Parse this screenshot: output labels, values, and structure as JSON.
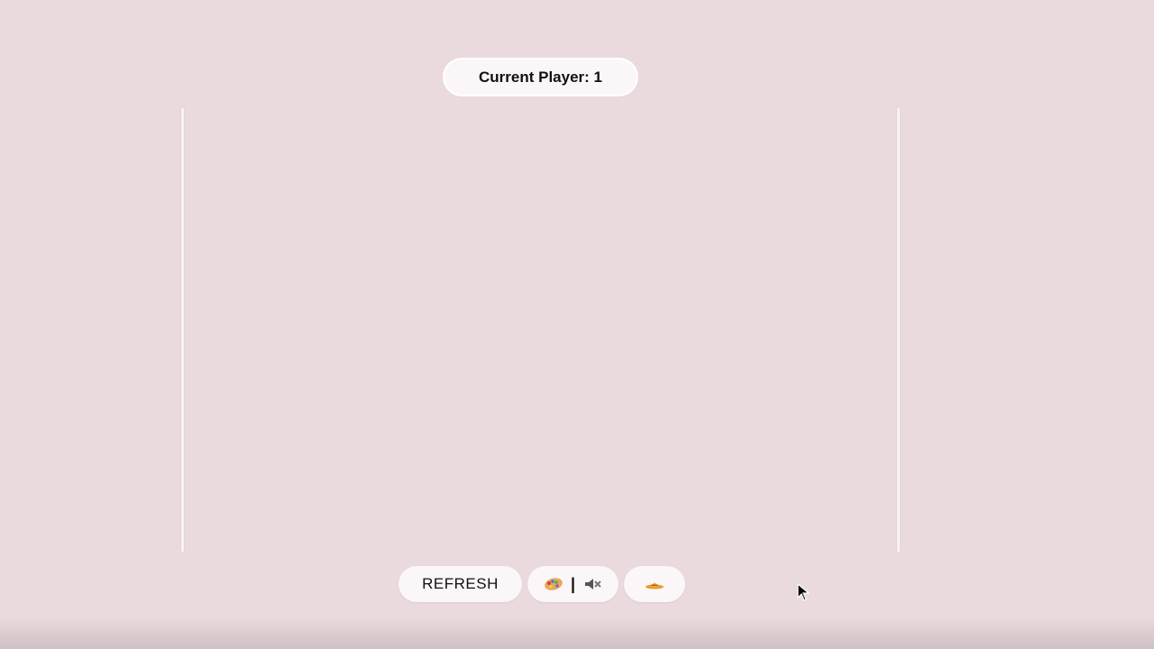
{
  "status": {
    "label": "Current Player: 1"
  },
  "controls": {
    "refresh_label": "REFRESH",
    "separator": "|",
    "theme_icon": "palette-icon",
    "sound_icon": "speaker-muted-icon",
    "extra_icon": "sombrero-hat-icon"
  },
  "colors": {
    "background": "#ead9dd",
    "pill": "#fbf6f7",
    "wall": "#f8f2f3"
  }
}
